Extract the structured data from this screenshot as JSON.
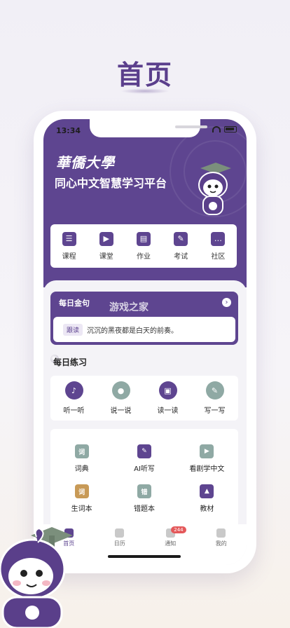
{
  "page_title": "首页",
  "status": {
    "time": "13:34"
  },
  "header": {
    "university_logo": "華僑大學",
    "platform_name": "同心中文智慧学习平台"
  },
  "top_nav": [
    {
      "label": "课程",
      "icon": "course-icon"
    },
    {
      "label": "课堂",
      "icon": "classroom-icon"
    },
    {
      "label": "作业",
      "icon": "homework-icon"
    },
    {
      "label": "考试",
      "icon": "exam-icon"
    },
    {
      "label": "社区",
      "icon": "community-icon"
    }
  ],
  "daily_quote": {
    "title": "每日金句",
    "tag": "跟读",
    "text": "沉沉的黑夜都是白天的前奏。",
    "watermark": "游戏之家"
  },
  "daily_practice": {
    "title": "每日练习",
    "items": [
      {
        "label": "听一听",
        "icon": "listen-icon",
        "color": "#5e4590"
      },
      {
        "label": "说一说",
        "icon": "microphone-icon",
        "color": "#8fa9a4"
      },
      {
        "label": "读一读",
        "icon": "read-icon",
        "color": "#5e4590"
      },
      {
        "label": "写一写",
        "icon": "pencil-icon",
        "color": "#8fa9a4"
      }
    ]
  },
  "tools": [
    {
      "label": "词典",
      "icon": "dictionary-icon",
      "glyph": "词",
      "color": "#8fa9a4"
    },
    {
      "label": "AI听写",
      "icon": "ai-dictation-icon",
      "glyph": "",
      "color": "#5e4590"
    },
    {
      "label": "看剧学中文",
      "icon": "video-icon",
      "glyph": "",
      "color": "#8fa9a4"
    },
    {
      "label": "生词本",
      "icon": "vocab-book-icon",
      "glyph": "词",
      "color": "#c89a57"
    },
    {
      "label": "错题本",
      "icon": "error-book-icon",
      "glyph": "错",
      "color": "#8fa9a4"
    },
    {
      "label": "教材",
      "icon": "textbook-icon",
      "glyph": "",
      "color": "#5e4590"
    }
  ],
  "bottom_nav": [
    {
      "label": "首页",
      "active": true
    },
    {
      "label": "日历",
      "active": false
    },
    {
      "label": "通知",
      "active": false,
      "badge": "244"
    },
    {
      "label": "我的",
      "active": false
    }
  ]
}
